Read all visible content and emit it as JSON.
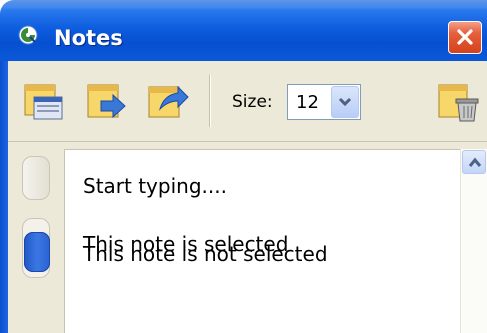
{
  "window": {
    "title": "Notes",
    "icons": {
      "app": "notes-app-icon",
      "close": "close-icon"
    }
  },
  "toolbar": {
    "buttons": [
      {
        "name": "new-note-button",
        "icon": "new-note-window-icon"
      },
      {
        "name": "import-note-button",
        "icon": "note-arrow-in-icon"
      },
      {
        "name": "export-note-button",
        "icon": "note-arrow-out-icon"
      }
    ],
    "size_label": "Size:",
    "size_value": "12",
    "delete_icon": "trash-note-icon"
  },
  "notes": {
    "lines": [
      "Start typing....",
      "This note is selected",
      "This note is not selected"
    ],
    "tabs": [
      {
        "state": "unselected"
      },
      {
        "state": "selected",
        "color": "#2a63d2"
      }
    ]
  },
  "colors": {
    "titlebar": "#0650d0",
    "toolbar_bg": "#ece9d8",
    "close_button": "#e8603c",
    "selected_tab": "#2a63d2"
  }
}
